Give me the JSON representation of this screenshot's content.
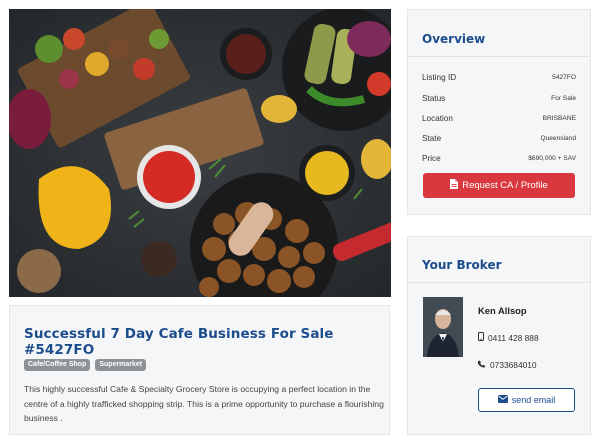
{
  "hero": {
    "image_alt": "Grilled vegetables, sausages, potatoes and sauces on a dark table"
  },
  "listing": {
    "title": "Successful 7 Day Cafe Business For Sale #5427FO",
    "tags": [
      "Cafe/Coffee Shop",
      "Supermarket"
    ],
    "description": "This highly successful Cafe & Specialty Grocery Store is occupying a perfect location in the centre of a highly trafficked shopping strip. This is a prime opportunity to purchase a flourishing business ."
  },
  "overview": {
    "heading": "Overview",
    "rows": [
      {
        "label": "Listing ID",
        "value": "5427FO"
      },
      {
        "label": "Status",
        "value": "For Sale"
      },
      {
        "label": "Location",
        "value": "BRISBANE"
      },
      {
        "label": "State",
        "value": "Queensland"
      },
      {
        "label": "Price",
        "value": "$690,000 + SAV"
      }
    ],
    "request_button": {
      "label": "Request CA / Profile",
      "icon": "file-icon"
    }
  },
  "broker": {
    "heading": "Your Broker",
    "name": "Ken Allsop",
    "mobile": "0411 428 888",
    "phone": "0733684010",
    "email_button": {
      "label": "send email",
      "icon": "envelope-icon"
    },
    "mobile_icon": "mobile-phone-icon",
    "phone_icon": "phone-icon"
  },
  "colors": {
    "accent_blue": "#1b4c8c",
    "request_red": "#d9383e",
    "tag_grey": "#8f9295",
    "card_bg": "#f5f6f7"
  }
}
